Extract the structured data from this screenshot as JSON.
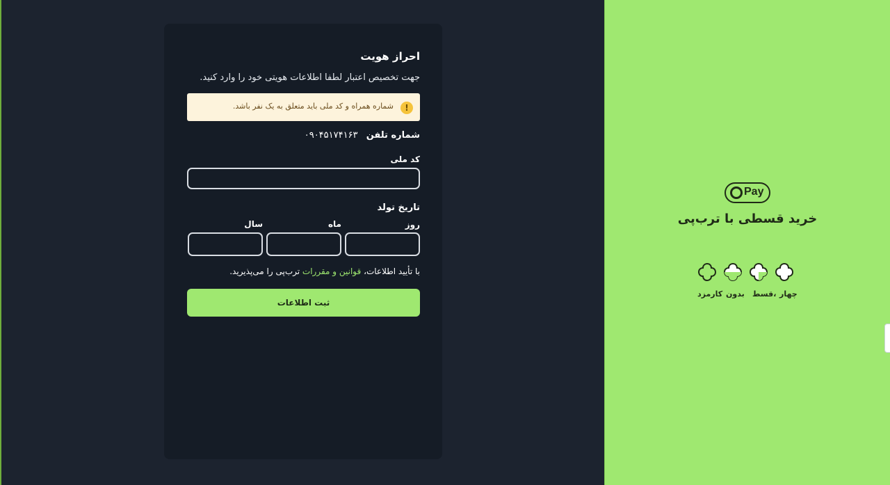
{
  "card": {
    "title": "احراز هویت",
    "subtitle": "جهت تخصیص اعتبار لطفا اطلاعات هویتی خود را وارد کنید.",
    "warning_text": "شماره همراه و کد ملی باید متعلق به یک نفر باشد.",
    "phone_label": "شماره تلفن",
    "phone_value": "۰۹۰۴۵۱۷۴۱۶۳",
    "national_code_label": "کد ملی",
    "national_code_value": "",
    "birth_date_label": "تاریخ تولد",
    "day_label": "روز",
    "month_label": "ماه",
    "year_label": "سال",
    "day_value": "",
    "month_value": "",
    "year_value": "",
    "terms_prefix": "با تأیید اطلاعات،",
    "terms_link": "قوانین و مقررات",
    "terms_suffix": "ترب‌پی را می‌پذیرید.",
    "submit_label": "ثبت اطلاعات"
  },
  "brand": {
    "logo_text": "Pay",
    "title": "خرید قسطی با ترب‌پی",
    "features": [
      "چهار",
      "قسط،",
      "بدون",
      "کارمزد"
    ]
  },
  "colors": {
    "accent": "#9fe870",
    "background": "#1c232f",
    "card": "#151c26",
    "warning_bg": "#fdf3dc",
    "warning_icon": "#f5c33b"
  },
  "icons": {
    "warning": "exclamation-icon",
    "brand": "torob-pay-logo",
    "feature": "flower-icon"
  }
}
